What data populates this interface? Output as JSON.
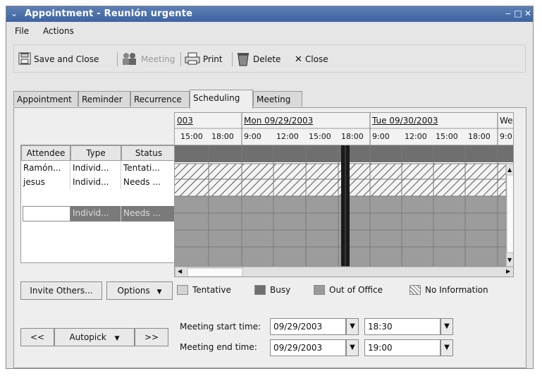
{
  "window": {
    "title": "Appointment - Reunión urgente"
  },
  "menubar": {
    "file": "File",
    "actions": "Actions"
  },
  "toolbar": {
    "save_close": "Save and Close",
    "meeting": "Meeting",
    "print": "Print",
    "delete": "Delete",
    "close": "Close"
  },
  "tabs": [
    {
      "label": "Appointment"
    },
    {
      "label": "Reminder"
    },
    {
      "label": "Recurrence"
    },
    {
      "label": "Scheduling"
    },
    {
      "label": "Meeting"
    }
  ],
  "attendees": {
    "headers": [
      "Attendee",
      "Type",
      "Status"
    ],
    "rows": [
      {
        "attendee": "Ramón...",
        "type": "Individ...",
        "status": "Tentati..."
      },
      {
        "attendee": "jesus",
        "type": "Individ...",
        "status": "Needs ..."
      }
    ],
    "new_row": {
      "attendee": "",
      "type": "Individ...",
      "status": "Needs ..."
    }
  },
  "schedule": {
    "dates": [
      "003",
      "Mon 09/29/2003",
      "Tue 09/30/2003",
      "We"
    ],
    "times": [
      "15:00",
      "18:00",
      "9:00",
      "12:00",
      "15:00",
      "18:00",
      "9:00",
      "12:00",
      "15:00",
      "18:00",
      "9:0"
    ]
  },
  "buttons": {
    "invite_others": "Invite Others...",
    "options": "Options",
    "prev": "<<",
    "autopick": "Autopick",
    "next": ">>"
  },
  "legend": {
    "tentative": "Tentative",
    "busy": "Busy",
    "out_of_office": "Out of Office",
    "no_information": "No Information"
  },
  "meeting_time": {
    "start_label": "Meeting start time:",
    "end_label": "Meeting end time:",
    "start_date": "09/29/2003",
    "start_time": "18:30",
    "end_date": "09/29/2003",
    "end_time": "19:00"
  },
  "colors": {
    "titlebar": "#4a6fa8",
    "busy": "#6f6f6f",
    "out_of_office": "#9a9a9a",
    "tentative": "#d3d3d3",
    "selection": "#1a1a1a"
  }
}
